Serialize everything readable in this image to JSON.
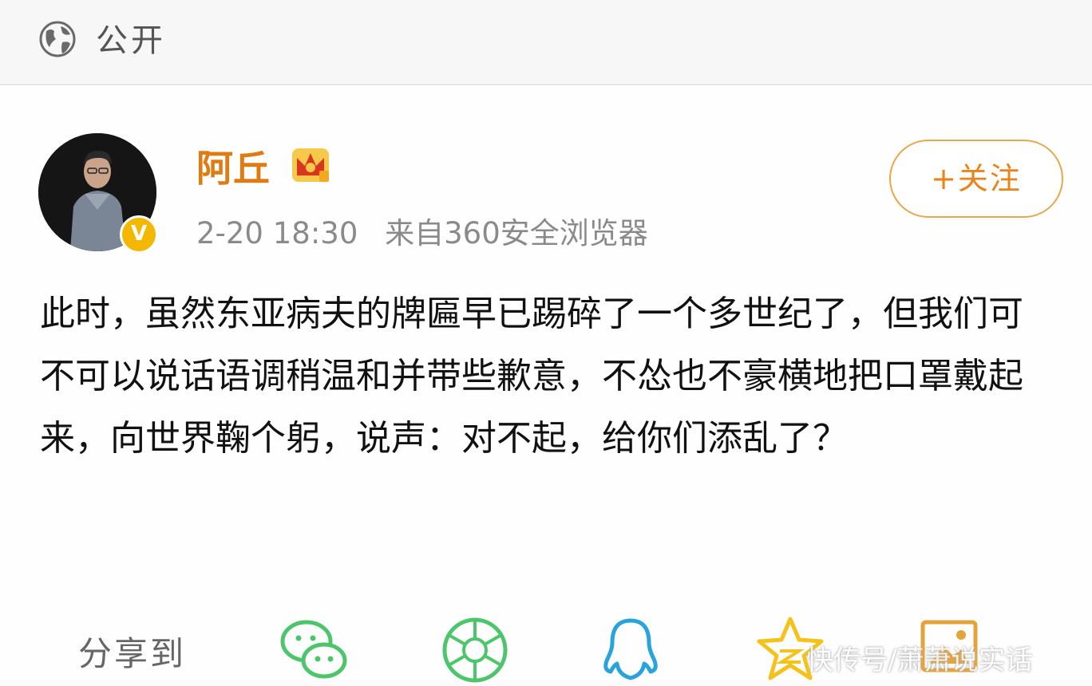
{
  "header": {
    "visibility_label": "公开",
    "visibility_icon": "globe-icon"
  },
  "post": {
    "author": {
      "name": "阿丘",
      "verified_badge": "V",
      "member_icon": "crown-icon"
    },
    "timestamp": "2-20 18:30",
    "source": "来自360安全浏览器",
    "follow_label": "+关注",
    "content": "此时，虽然东亚病夫的牌匾早已踢碎了一个多世纪了，但我们可不可以说话语调稍温和并带些歉意，不怂也不豪横地把口罩戴起来，向世界鞠个躬，说声：对不起，给你们添乱了？"
  },
  "share": {
    "label": "分享到",
    "targets": [
      {
        "name": "wechat-icon"
      },
      {
        "name": "moments-icon"
      },
      {
        "name": "qq-icon"
      },
      {
        "name": "qzone-icon"
      },
      {
        "name": "image-icon"
      }
    ]
  },
  "watermark": "快传号/萧萧说实话",
  "colors": {
    "accent": "#e8841a",
    "username": "#e07a12",
    "verified": "#f5b800",
    "share_green": "#4cc56b",
    "qq_blue": "#29a3dc",
    "qzone_yellow": "#f4c21a"
  }
}
